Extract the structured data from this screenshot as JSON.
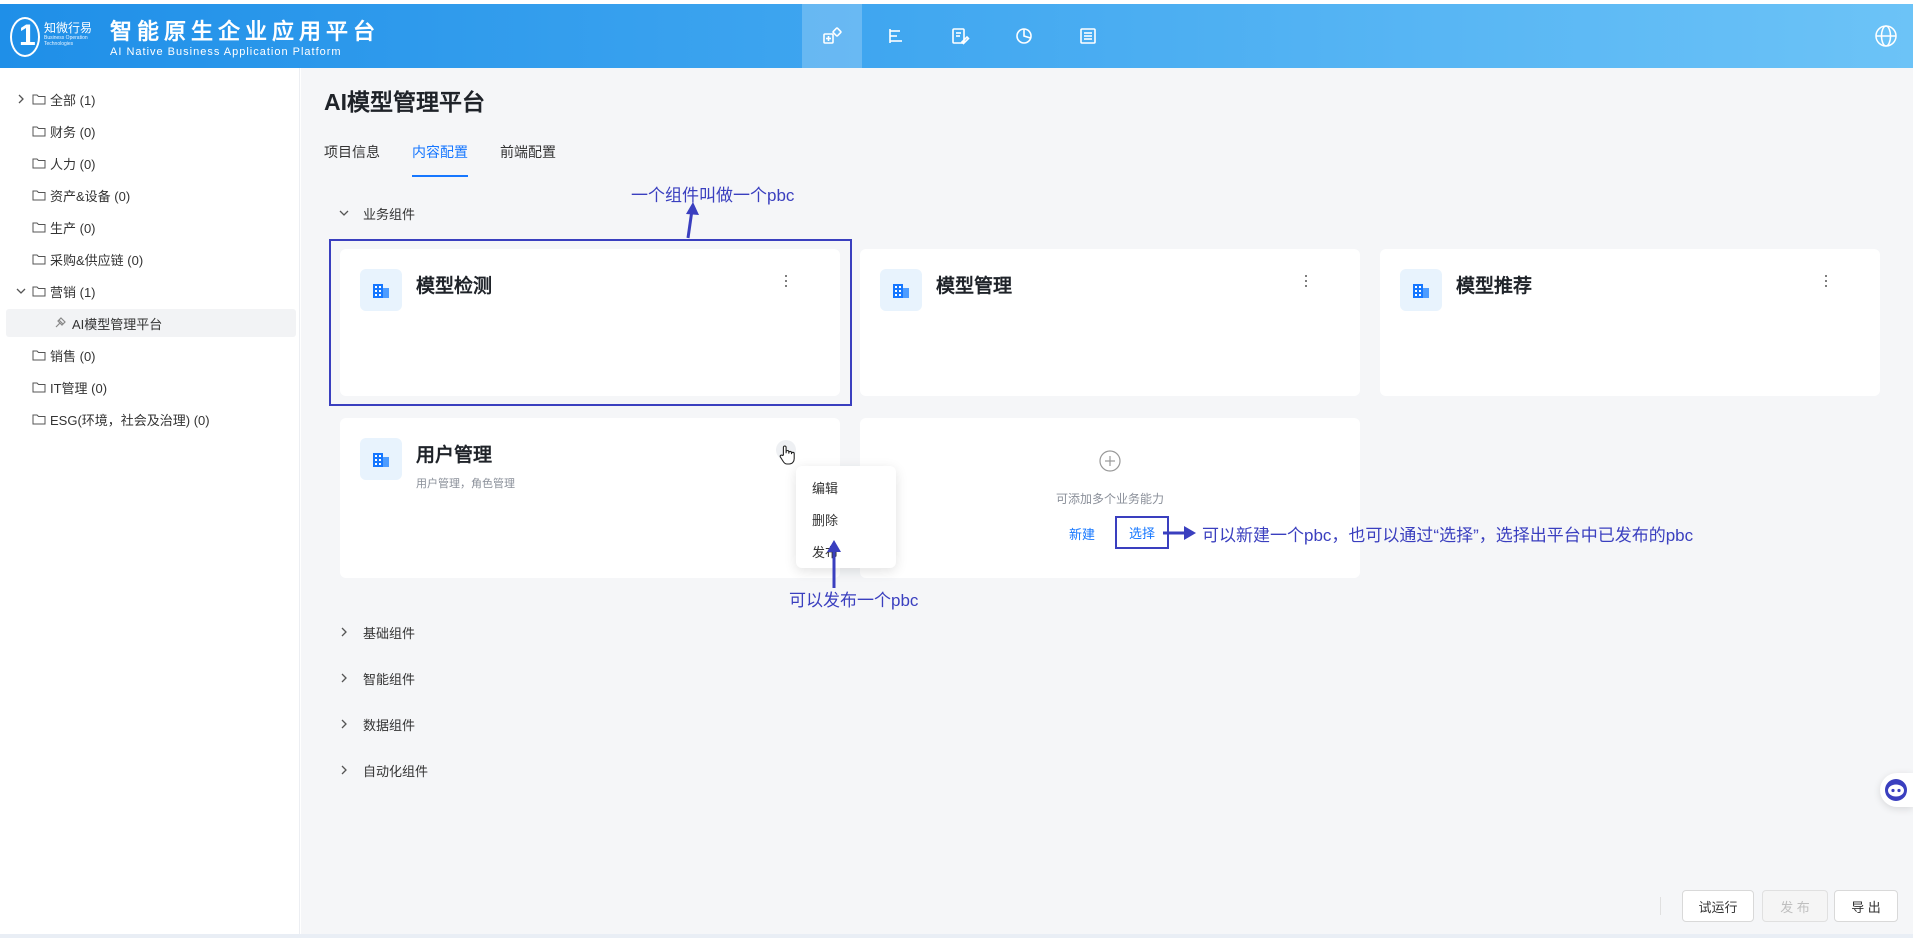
{
  "header": {
    "logo_name": "知微行易",
    "logo_sub": "Business Operation Technologies",
    "title": "智能原生企业应用平台",
    "subtitle": "AI Native Business Application Platform",
    "nav_icons": [
      "component-icon",
      "structure-icon",
      "edit-doc-icon",
      "chart-pie-icon",
      "layers-icon"
    ],
    "active_nav": 0
  },
  "sidebar": {
    "items": [
      {
        "label": "全部 (1)",
        "chevron": "right"
      },
      {
        "label": "财务 (0)"
      },
      {
        "label": "人力 (0)"
      },
      {
        "label": "资产&设备 (0)"
      },
      {
        "label": "生产 (0)"
      },
      {
        "label": "采购&供应链 (0)"
      },
      {
        "label": "营销 (1)",
        "chevron": "down"
      },
      {
        "label": "AI模型管理平台",
        "leaf": true,
        "selected": true
      },
      {
        "label": "销售 (0)"
      },
      {
        "label": "IT管理 (0)"
      },
      {
        "label": "ESG(环境，社会及治理) (0)"
      }
    ]
  },
  "main": {
    "title": "AI模型管理平台",
    "tabs": [
      {
        "label": "项目信息"
      },
      {
        "label": "内容配置",
        "active": true
      },
      {
        "label": "前端配置"
      }
    ],
    "sections": [
      {
        "label": "业务组件",
        "expanded": true
      },
      {
        "label": "基础组件"
      },
      {
        "label": "智能组件"
      },
      {
        "label": "数据组件"
      },
      {
        "label": "自动化组件"
      }
    ],
    "cards": [
      {
        "title": "模型检测",
        "desc": ""
      },
      {
        "title": "模型管理",
        "desc": ""
      },
      {
        "title": "模型推荐",
        "desc": ""
      },
      {
        "title": "用户管理",
        "desc": "用户管理，角色管理"
      }
    ],
    "add_card": {
      "text": "可添加多个业务能力",
      "new_label": "新建",
      "choose_label": "选择"
    },
    "dropdown": [
      "编辑",
      "删除",
      "发布"
    ]
  },
  "annotations": {
    "pbc_definition": "一个组件叫做一个pbc",
    "publish_note": "可以发布一个pbc",
    "choose_note": "可以新建一个pbc，也可以通过“选择”，选择出平台中已发布的pbc"
  },
  "footer": {
    "trial_run": "试运行",
    "publish": "发 布",
    "export": "导 出"
  },
  "colors": {
    "accent": "#1677ff",
    "annotation": "#3a3fbf",
    "header_start": "#1f8fe8",
    "header_end": "#6cc3f7"
  }
}
